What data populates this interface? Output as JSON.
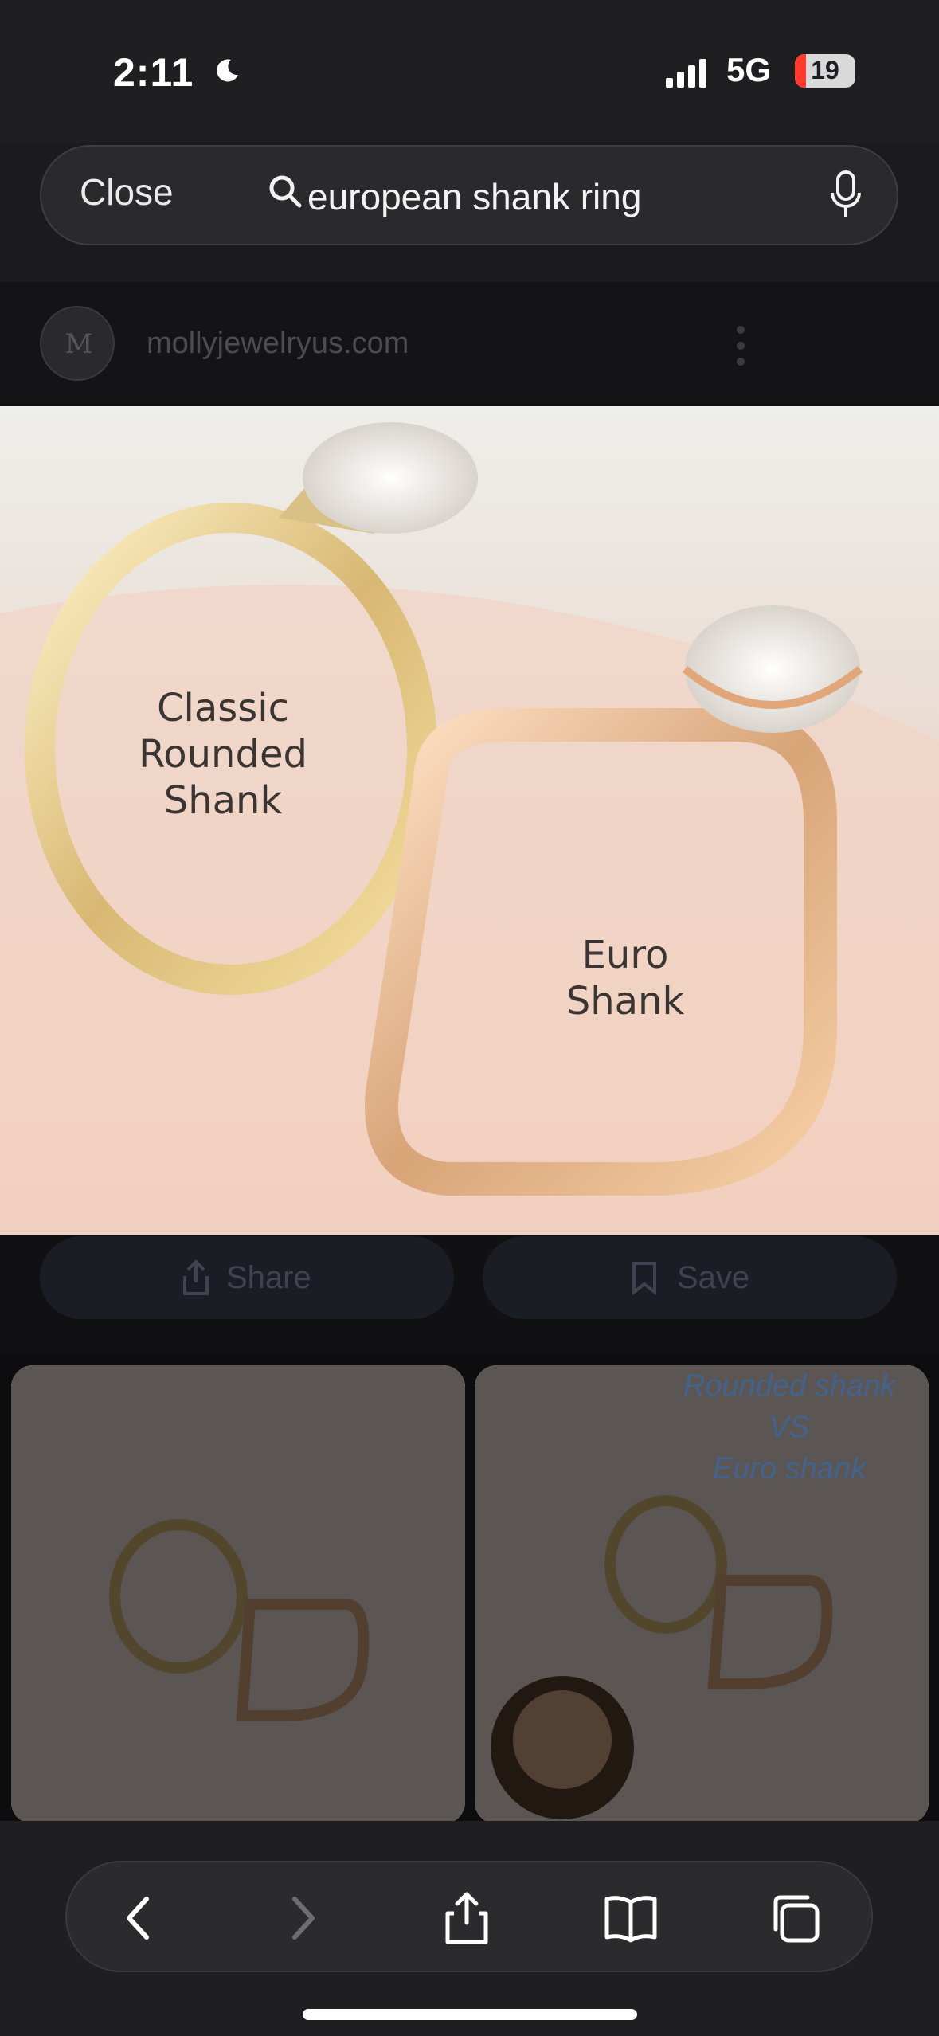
{
  "status_bar": {
    "time": "2:11",
    "network": "5G",
    "battery": "19"
  },
  "search": {
    "close_label": "Close",
    "query": "european shank ring"
  },
  "source": {
    "site": "mollyjewelryus.com"
  },
  "hero_image": {
    "label_left": "Classic\nRounded\nShank",
    "label_right": "Euro\nShank"
  },
  "actions": {
    "share_label": "Share",
    "save_label": "Save"
  },
  "results": [
    {
      "caption": ""
    },
    {
      "caption": "Rounded shank\nVS\nEuro shank"
    }
  ],
  "toolbar": {
    "items": [
      "back",
      "forward",
      "share",
      "bookmarks",
      "tabs"
    ]
  }
}
